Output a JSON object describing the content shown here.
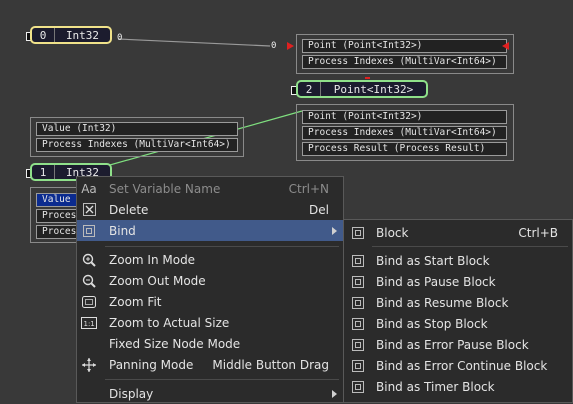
{
  "colors": {
    "canvas_bg": "#393939",
    "var_border_yellow": "#f0e28a",
    "var_border_green": "#8fe08a",
    "link_red": "#e02020",
    "menu_highlight": "#415a8a",
    "selected_row": "#0b2b8f"
  },
  "nodes": {
    "var0": {
      "index": "0",
      "type": "Int32",
      "port_out_label": "0"
    },
    "var2": {
      "index": "2",
      "type": "Point<Int32>"
    },
    "var1": {
      "index": "1",
      "type": "Int32"
    },
    "group_top": {
      "port_in_label": "0",
      "rows": [
        "Point (Point<Int32>)",
        "Process Indexes (MultiVar<Int64>)"
      ]
    },
    "group_mid": {
      "rows": [
        "Point (Point<Int32>)",
        "Process Indexes (MultiVar<Int64>)",
        "Process Result (Process Result)"
      ]
    },
    "group_left": {
      "rows": [
        "Value (Int32)",
        "Process Indexes (MultiVar<Int64>)"
      ]
    },
    "group_left_bottom": {
      "rows": [
        "Value",
        "Proces",
        "Proces"
      ]
    }
  },
  "context_menu": {
    "items": [
      {
        "label": "Set Variable Name",
        "shortcut": "Ctrl+N",
        "icon": "text-aa-icon",
        "disabled": true
      },
      {
        "label": "Delete",
        "shortcut": "Del",
        "icon": "delete-x-icon"
      },
      {
        "label": "Bind",
        "shortcut": "",
        "icon": "bind-icon",
        "active": true,
        "submenu": true
      },
      {
        "label": "Zoom In Mode",
        "shortcut": "",
        "icon": "zoom-in-icon"
      },
      {
        "label": "Zoom Out Mode",
        "shortcut": "",
        "icon": "zoom-out-icon"
      },
      {
        "label": "Zoom Fit",
        "shortcut": "",
        "icon": "zoom-fit-icon"
      },
      {
        "label": "Zoom to Actual Size",
        "shortcut": "",
        "icon": "zoom-actual-icon"
      },
      {
        "label": "Fixed Size Node Mode",
        "shortcut": "",
        "icon": ""
      },
      {
        "label": "Panning Mode",
        "shortcut": "Middle Button Drag",
        "icon": "pan-icon"
      },
      {
        "label": "Display",
        "shortcut": "",
        "icon": "",
        "submenu": true
      }
    ]
  },
  "bind_submenu": {
    "items": [
      {
        "label": "Block",
        "shortcut": "Ctrl+B"
      },
      {
        "label": "Bind as Start Block",
        "shortcut": ""
      },
      {
        "label": "Bind as Pause Block",
        "shortcut": ""
      },
      {
        "label": "Bind as Resume Block",
        "shortcut": ""
      },
      {
        "label": "Bind as Stop Block",
        "shortcut": ""
      },
      {
        "label": "Bind as Error Pause Block",
        "shortcut": ""
      },
      {
        "label": "Bind as Error Continue Block",
        "shortcut": ""
      },
      {
        "label": "Bind as Timer Block",
        "shortcut": ""
      }
    ]
  }
}
